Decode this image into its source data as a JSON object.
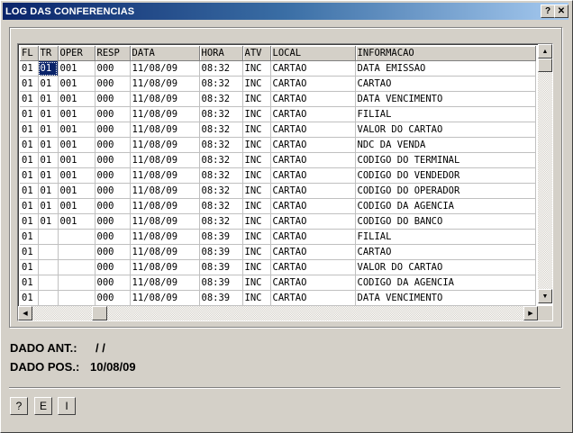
{
  "window": {
    "title": "LOG DAS CONFERENCIAS",
    "help_button": "?",
    "close_button": "✕"
  },
  "grid": {
    "columns": [
      "FL",
      "TR",
      "OPER",
      "RESP",
      "DATA",
      "HORA",
      "ATV",
      "LOCAL",
      "INFORMACAO"
    ],
    "rows": [
      [
        "01",
        "01",
        "001",
        "000",
        "11/08/09",
        "08:32",
        "INC",
        "CARTAO",
        "DATA EMISSAO"
      ],
      [
        "01",
        "01",
        "001",
        "000",
        "11/08/09",
        "08:32",
        "INC",
        "CARTAO",
        "CARTAO"
      ],
      [
        "01",
        "01",
        "001",
        "000",
        "11/08/09",
        "08:32",
        "INC",
        "CARTAO",
        "DATA VENCIMENTO"
      ],
      [
        "01",
        "01",
        "001",
        "000",
        "11/08/09",
        "08:32",
        "INC",
        "CARTAO",
        "FILIAL"
      ],
      [
        "01",
        "01",
        "001",
        "000",
        "11/08/09",
        "08:32",
        "INC",
        "CARTAO",
        "VALOR DO CARTAO"
      ],
      [
        "01",
        "01",
        "001",
        "000",
        "11/08/09",
        "08:32",
        "INC",
        "CARTAO",
        "NDC DA VENDA"
      ],
      [
        "01",
        "01",
        "001",
        "000",
        "11/08/09",
        "08:32",
        "INC",
        "CARTAO",
        "CODIGO DO TERMINAL"
      ],
      [
        "01",
        "01",
        "001",
        "000",
        "11/08/09",
        "08:32",
        "INC",
        "CARTAO",
        "CODIGO DO VENDEDOR"
      ],
      [
        "01",
        "01",
        "001",
        "000",
        "11/08/09",
        "08:32",
        "INC",
        "CARTAO",
        "CODIGO DO OPERADOR"
      ],
      [
        "01",
        "01",
        "001",
        "000",
        "11/08/09",
        "08:32",
        "INC",
        "CARTAO",
        "CODIGO DA AGENCIA"
      ],
      [
        "01",
        "01",
        "001",
        "000",
        "11/08/09",
        "08:32",
        "INC",
        "CARTAO",
        "CODIGO DO BANCO"
      ],
      [
        "01",
        "",
        "",
        "000",
        "11/08/09",
        "08:39",
        "INC",
        "CARTAO",
        "FILIAL"
      ],
      [
        "01",
        "",
        "",
        "000",
        "11/08/09",
        "08:39",
        "INC",
        "CARTAO",
        "CARTAO"
      ],
      [
        "01",
        "",
        "",
        "000",
        "11/08/09",
        "08:39",
        "INC",
        "CARTAO",
        "VALOR DO CARTAO"
      ],
      [
        "01",
        "",
        "",
        "000",
        "11/08/09",
        "08:39",
        "INC",
        "CARTAO",
        "CODIGO DA AGENCIA"
      ],
      [
        "01",
        "",
        "",
        "000",
        "11/08/09",
        "08:39",
        "INC",
        "CARTAO",
        "DATA VENCIMENTO"
      ]
    ],
    "selected_cell": {
      "row": 0,
      "col": 1
    }
  },
  "fields": {
    "dado_ant_label": "DADO ANT.:",
    "dado_ant_value": "/ /",
    "dado_pos_label": "DADO POS.:",
    "dado_pos_value": "10/08/09"
  },
  "buttons": [
    "?",
    "E",
    "I"
  ],
  "icons": {
    "scroll_up": "up-arrow-icon",
    "scroll_down": "down-arrow-icon",
    "scroll_left": "left-arrow-icon",
    "scroll_right": "right-arrow-icon"
  },
  "colors": {
    "titlebar_start": "#0a246a",
    "titlebar_end": "#a6caf0",
    "face": "#d4d0c8",
    "selection": "#0a246a"
  }
}
